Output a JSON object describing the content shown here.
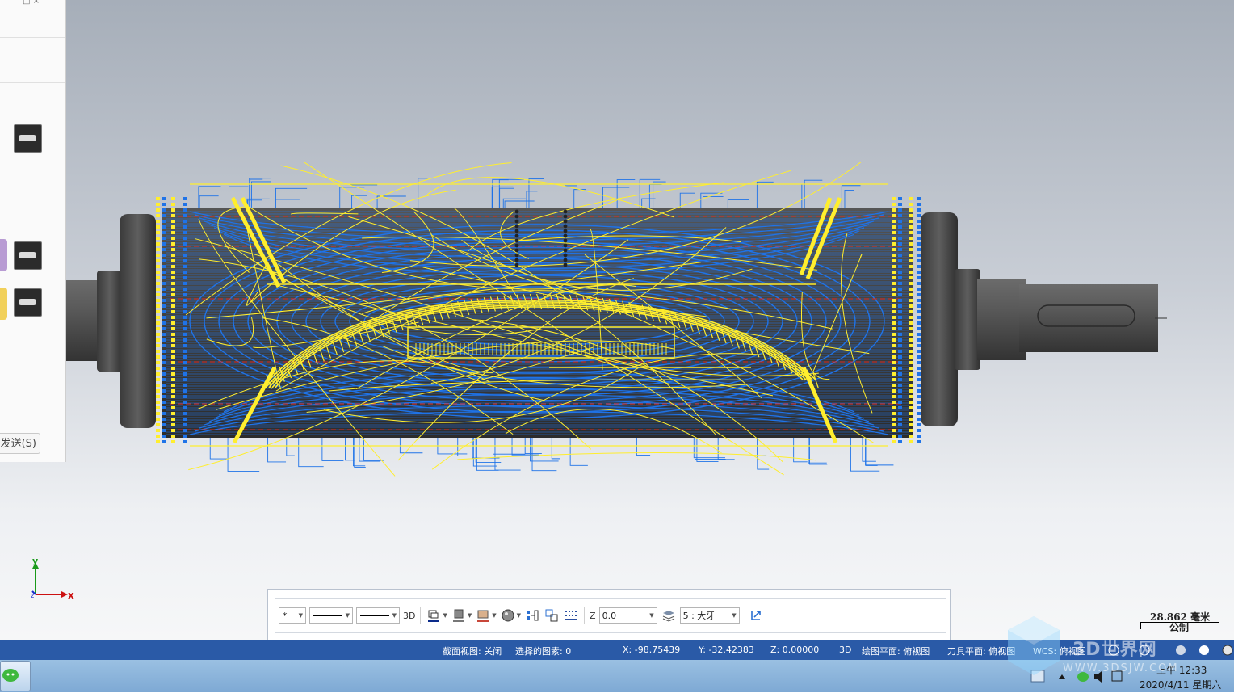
{
  "left_panel": {
    "send_label": "发送(S)",
    "window_controls": "□ ×",
    "thumbnails": [
      "toolpath-thumb-1",
      "toolpath-thumb-2",
      "toolpath-thumb-3"
    ]
  },
  "axis_indicator": {
    "y_label": "y",
    "x_label": "x",
    "z_label": "z"
  },
  "toolbar": {
    "point_style": "*",
    "mode_3d": "3D",
    "z_label": "Z",
    "z_value": "0.0",
    "level_value": "5 : 大牙"
  },
  "status_bar": {
    "section_view": "截面视图: 关闭",
    "selected": "选择的图素: 0",
    "x": "X:  -98.75439",
    "y": "Y:  -32.42383",
    "z": "Z:  0.00000",
    "mode": "3D",
    "drawing_plane": "绘图平面: 俯视图",
    "tool_plane": "刀具平面: 俯视图",
    "wcs": "WCS: 俯视图"
  },
  "scale": {
    "value": "28.862 毫米",
    "unit_system": "公制"
  },
  "taskbar": {
    "time": "上午 12:33",
    "date": "2020/4/11 星期六"
  },
  "watermark": {
    "brand": "3D世界网",
    "url": "WWW.3DSJW.COM"
  },
  "colors": {
    "toolpath_blue": "#1f73e8",
    "toolpath_yellow": "#ffee2e",
    "rapid_red": "#e0302a",
    "part_gray": "#4a4a4a",
    "status_bar": "#2a5aa7"
  }
}
